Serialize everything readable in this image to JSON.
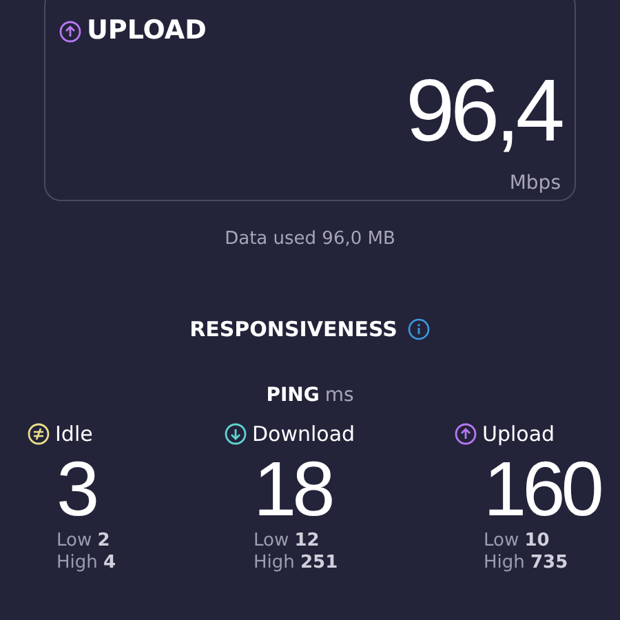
{
  "result_card": {
    "title": "UPLOAD",
    "value": "96,4",
    "unit": "Mbps"
  },
  "data_used": "Data used 96,0 MB",
  "responsiveness": {
    "title": "RESPONSIVENESS"
  },
  "ping": {
    "title": "PING",
    "unit": "ms",
    "columns": [
      {
        "kind": "idle",
        "label": "Idle",
        "color": "#e8e08a",
        "value": "3",
        "low_label": "Low",
        "low": "2",
        "high_label": "High",
        "high": "4"
      },
      {
        "kind": "download",
        "label": "Download",
        "color": "#5fd4cf",
        "value": "18",
        "low_label": "Low",
        "low": "12",
        "high_label": "High",
        "high": "251"
      },
      {
        "kind": "upload",
        "label": "Upload",
        "color": "#b678f0",
        "value": "160",
        "low_label": "Low",
        "low": "10",
        "high_label": "High",
        "high": "735"
      }
    ]
  }
}
